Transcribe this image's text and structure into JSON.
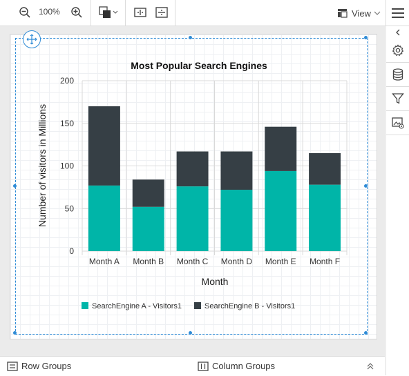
{
  "toolbar": {
    "zoom_out_icon": "zoom-out-icon",
    "zoom_value": "100%",
    "zoom_in_icon": "zoom-in-icon",
    "view_label": "View"
  },
  "bottom": {
    "row_groups": "Row Groups",
    "column_groups": "Column Groups"
  },
  "colors": {
    "series_a": "#00b5a8",
    "series_b": "#363f45",
    "accent": "#2e8bd6"
  },
  "chart_data": {
    "type": "bar",
    "stacked": true,
    "title": "Most Popular Search Engines",
    "xlabel": "Month",
    "ylabel": "Number of visitors in Millions",
    "ylim": [
      0,
      200
    ],
    "yticks": [
      0,
      50,
      100,
      150,
      200
    ],
    "grid": true,
    "legend_position": "bottom",
    "categories": [
      "Month A",
      "Month B",
      "Month C",
      "Month D",
      "Month E",
      "Month F"
    ],
    "series": [
      {
        "name": "SearchEngine A - Visitors1",
        "color": "#00b5a8",
        "values": [
          77,
          52,
          76,
          72,
          94,
          78
        ]
      },
      {
        "name": "SearchEngine B - Visitors1",
        "color": "#363f45",
        "values": [
          93,
          32,
          41,
          45,
          52,
          37
        ]
      }
    ]
  }
}
